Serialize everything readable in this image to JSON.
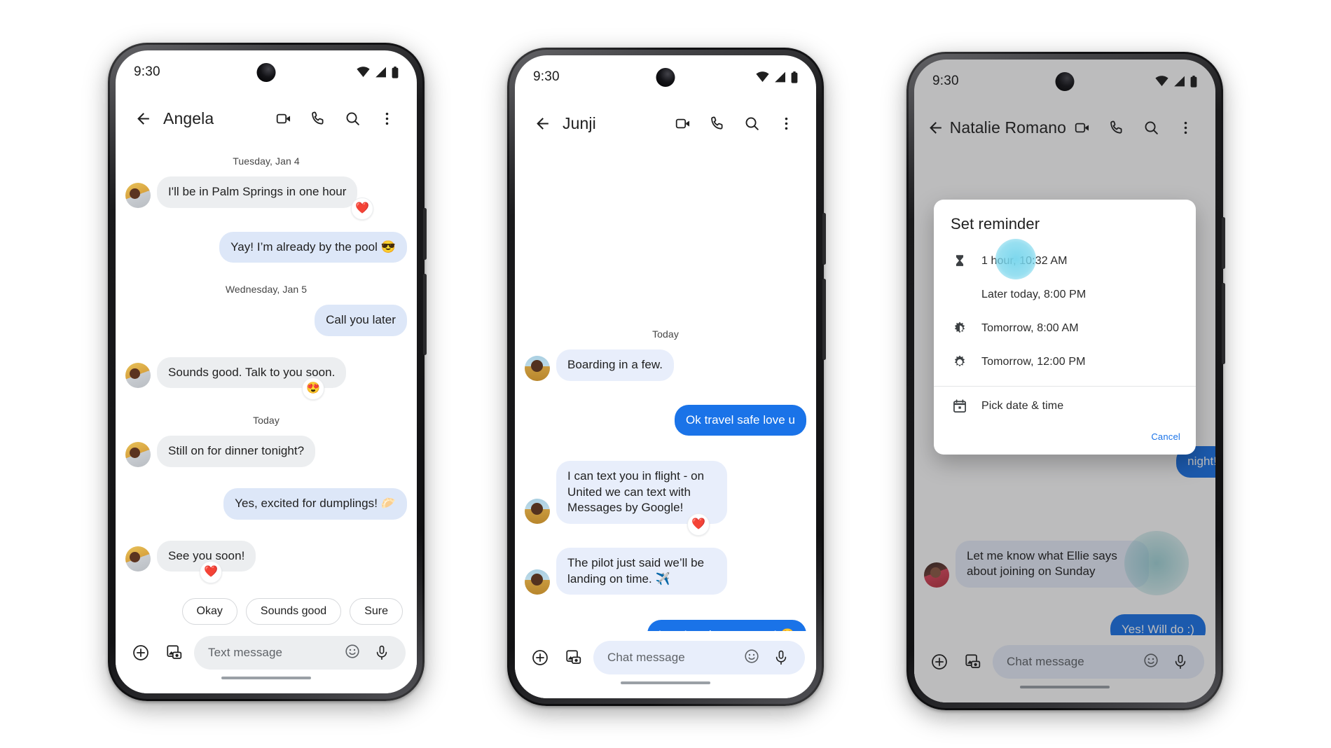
{
  "statusbar": {
    "time": "9:30",
    "icons": [
      "wifi-icon",
      "cellular-icon",
      "battery-icon"
    ]
  },
  "common": {
    "icons": {
      "back": "back-arrow-icon",
      "video": "video-call-icon",
      "call": "phone-call-icon",
      "search": "search-icon",
      "overflow": "more-vert-icon",
      "plus": "plus-circle-icon",
      "gallery": "gallery-icon",
      "emoji": "emoji-icon",
      "mic": "microphone-icon"
    }
  },
  "phones": [
    {
      "id": "phone-angela",
      "title": "Angela",
      "composer": {
        "placeholder": "Text message",
        "style": "sms"
      },
      "chips": [
        "Okay",
        "Sounds good",
        "Sure"
      ],
      "thread": [
        {
          "type": "day",
          "text": "Tuesday, Jan 4"
        },
        {
          "type": "msg",
          "side": "in",
          "style": "sms",
          "text": "I'll be in Palm Springs in one hour",
          "avatar": "av-a",
          "reaction": "❤️",
          "reaction_side": "right"
        },
        {
          "type": "msg",
          "side": "out",
          "style": "sms",
          "text": "Yay! I’m already by the pool 😎"
        },
        {
          "type": "day",
          "text": "Wednesday, Jan 5"
        },
        {
          "type": "msg",
          "side": "out",
          "style": "sms",
          "text": "Call you later"
        },
        {
          "type": "msg",
          "side": "in",
          "style": "sms",
          "text": "Sounds good. Talk to you soon.",
          "avatar": "av-a",
          "reaction": "😍",
          "reaction_side": "right"
        },
        {
          "type": "day",
          "text": "Today"
        },
        {
          "type": "msg",
          "side": "in",
          "style": "sms",
          "text": "Still on for dinner tonight?",
          "avatar": "av-a"
        },
        {
          "type": "msg",
          "side": "out",
          "style": "sms",
          "text": "Yes, excited for dumplings! 🥟"
        },
        {
          "type": "msg",
          "side": "in",
          "style": "sms",
          "text": "See you soon!",
          "avatar": "av-a",
          "reaction": "❤️",
          "reaction_side": "left"
        }
      ]
    },
    {
      "id": "phone-junji",
      "title": "Junji",
      "composer": {
        "placeholder": "Chat message",
        "style": "rcs"
      },
      "chips": [],
      "thread": [
        {
          "type": "day",
          "text": "Today"
        },
        {
          "type": "msg",
          "side": "in",
          "style": "rcs",
          "text": "Boarding in a few.",
          "avatar": "av-j"
        },
        {
          "type": "msg",
          "side": "out",
          "style": "blue",
          "text": "Ok travel safe love u"
        },
        {
          "type": "msg",
          "side": "in",
          "style": "rcs",
          "text": "I can text you in flight - on United we can text with Messages by Google!",
          "avatar": "av-j",
          "reaction": "❤️",
          "reaction_side": "right"
        },
        {
          "type": "msg",
          "side": "in",
          "style": "rcs",
          "text": "The pilot just said we’ll be landing on time. ✈️",
          "avatar": "av-j"
        },
        {
          "type": "msg",
          "side": "out",
          "style": "blue",
          "text": "I can’t wait to see you! 😍"
        }
      ]
    },
    {
      "id": "phone-natalie",
      "title": "Natalie Romano",
      "composer": {
        "placeholder": "Chat message",
        "style": "rcs"
      },
      "chips": [],
      "thread": [
        {
          "type": "msg",
          "side": "out",
          "style": "blue",
          "text": "night!",
          "clipped": true
        },
        {
          "type": "msg",
          "side": "in",
          "style": "rcs",
          "text": "Let me know what Ellie says about joining on Sunday",
          "avatar": "av-n",
          "ripple": true
        },
        {
          "type": "msg",
          "side": "out",
          "style": "blue",
          "text": "Yes! Will do :)"
        }
      ],
      "dialog": {
        "title": "Set reminder",
        "options": [
          {
            "icon": "hourglass-icon",
            "label": "1 hour, 10:32 AM",
            "ripple": true
          },
          {
            "icon": "moon-icon",
            "label": "Later today, 8:00 PM"
          },
          {
            "icon": "sunrise-icon",
            "label": "Tomorrow, 8:00 AM"
          },
          {
            "icon": "sun-icon",
            "label": "Tomorrow, 12:00 PM"
          }
        ],
        "pick": {
          "icon": "calendar-icon",
          "label": "Pick date & time"
        },
        "cancel": "Cancel"
      }
    }
  ],
  "colors": {
    "accent_blue": "#1a73e8",
    "sms_in": "#eceef0",
    "sms_out": "#dde7f8",
    "rcs_in": "#e8eefb",
    "ripple": "#76d5ec"
  }
}
